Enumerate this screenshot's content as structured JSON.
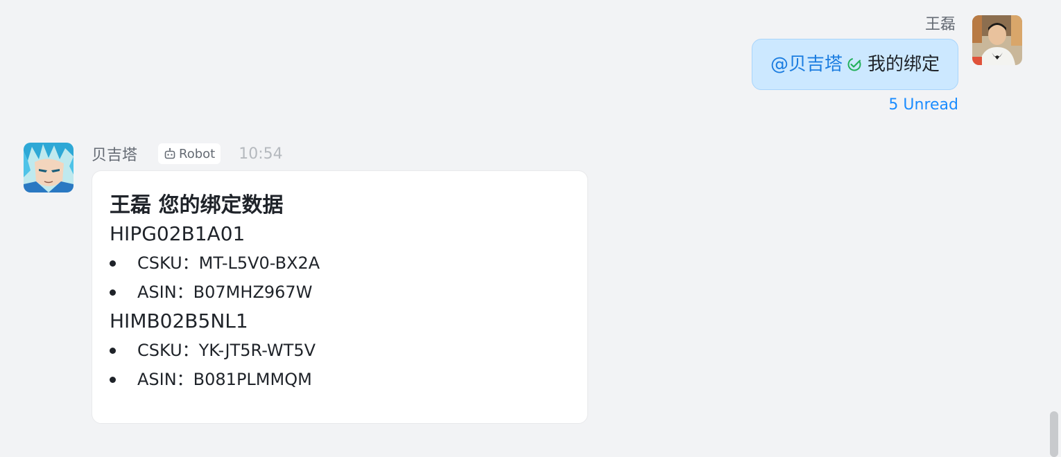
{
  "outgoing": {
    "sender": "王磊",
    "mention": "@贝吉塔",
    "text": "我的绑定",
    "unread": "5 Unread",
    "avatar_icon": "user-photo-avatar"
  },
  "incoming": {
    "sender": "贝吉塔",
    "tag": "Robot",
    "time": "10:54",
    "avatar_icon": "anime-character-avatar",
    "card": {
      "title": "王磊 您的绑定数据",
      "items": [
        {
          "code": "HIPG02B1A01",
          "csku": "CSKU：MT-L5V0-BX2A",
          "asin": "ASIN：B07MHZ967W"
        },
        {
          "code": "HIMB02B5NL1",
          "csku": "CSKU：YK-JT5R-WT5V",
          "asin": "ASIN：B081PLMMQM"
        }
      ]
    }
  },
  "colors": {
    "mention": "#1a7ce0",
    "unread": "#1a8cff",
    "bubble": "#cce8ff",
    "check": "#22b05a"
  }
}
